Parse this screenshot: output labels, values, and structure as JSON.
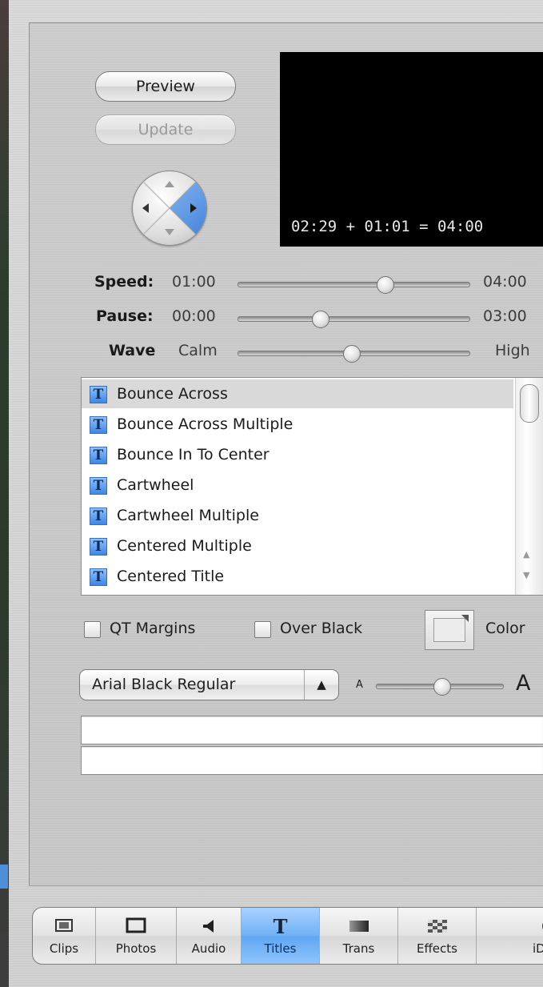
{
  "preview": {
    "preview_button": "Preview",
    "update_button": "Update",
    "timecode": "02:29 + 01:01 = 04:00"
  },
  "sliders": [
    {
      "label": "Speed:",
      "min": "01:00",
      "max": "04:00",
      "value_fraction": 0.62
    },
    {
      "label": "Pause:",
      "min": "00:00",
      "max": "03:00",
      "value_fraction": 0.36
    },
    {
      "label": "Wave",
      "min": "Calm",
      "max": "High",
      "value_fraction": 0.5
    }
  ],
  "titles_list": {
    "items": [
      {
        "label": "Bounce Across",
        "selected": true
      },
      {
        "label": "Bounce Across Multiple",
        "selected": false
      },
      {
        "label": "Bounce In To Center",
        "selected": false
      },
      {
        "label": "Cartwheel",
        "selected": false
      },
      {
        "label": "Cartwheel Multiple",
        "selected": false
      },
      {
        "label": "Centered Multiple",
        "selected": false
      },
      {
        "label": "Centered Title",
        "selected": false
      }
    ]
  },
  "options": {
    "qt_margins": "QT Margins",
    "over_black": "Over Black",
    "color": "Color"
  },
  "font": {
    "selected": "Arial Black Regular",
    "size_small": "A",
    "size_large": "A",
    "size_fraction": 0.45
  },
  "toolbar": {
    "buttons": [
      {
        "label": "Clips",
        "icon": "clips-icon"
      },
      {
        "label": "Photos",
        "icon": "photos-icon"
      },
      {
        "label": "Audio",
        "icon": "audio-icon"
      },
      {
        "label": "Titles",
        "icon": "titles-icon",
        "active": true
      },
      {
        "label": "Trans",
        "icon": "transitions-icon"
      },
      {
        "label": "Effects",
        "icon": "effects-icon"
      },
      {
        "label": "iD",
        "icon": "idvd-icon"
      }
    ]
  },
  "colors": {
    "accent_blue": "#5fa6f2",
    "preview_bg": "#000000"
  }
}
